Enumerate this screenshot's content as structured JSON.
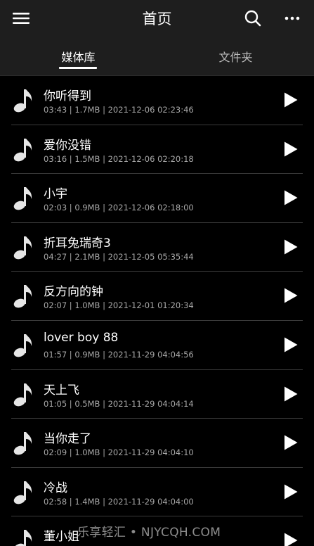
{
  "header": {
    "title": "首页",
    "icons": {
      "menu": "menu-icon",
      "search": "search-icon",
      "more": "more-icon"
    }
  },
  "tabs": [
    {
      "label": "媒体库",
      "active": true
    },
    {
      "label": "文件夹",
      "active": false
    }
  ],
  "songs": [
    {
      "title": "你听得到",
      "meta": "03:43 | 1.7MB | 2021-12-06 02:23:46"
    },
    {
      "title": "爱你没错",
      "meta": "03:16 | 1.5MB | 2021-12-06 02:20:18"
    },
    {
      "title": "小宇",
      "meta": "02:03 | 0.9MB | 2021-12-06 02:18:00"
    },
    {
      "title": "折耳兔瑞奇3",
      "meta": "04:27 | 2.1MB | 2021-12-05 05:35:44"
    },
    {
      "title": "反方向的钟",
      "meta": "02:07 | 1.0MB | 2021-12-01 01:20:34"
    },
    {
      "title": "lover boy 88",
      "meta": "01:57 | 0.9MB | 2021-11-29 04:04:56"
    },
    {
      "title": "天上飞",
      "meta": "01:05 | 0.5MB | 2021-11-29 04:04:14"
    },
    {
      "title": "当你走了",
      "meta": "02:09 | 1.0MB | 2021-11-29 04:04:10"
    },
    {
      "title": "冷战",
      "meta": "02:58 | 1.4MB | 2021-11-29 04:04:00"
    },
    {
      "title": "董小姐",
      "meta": ""
    }
  ],
  "watermark": "乐享轻汇 • NJYCQH.COM",
  "colors": {
    "background": "#000000",
    "bar": "#1e1e1e",
    "divider": "#3b3b3b",
    "text_primary": "#ffffff",
    "text_secondary": "#a8a8a8"
  }
}
